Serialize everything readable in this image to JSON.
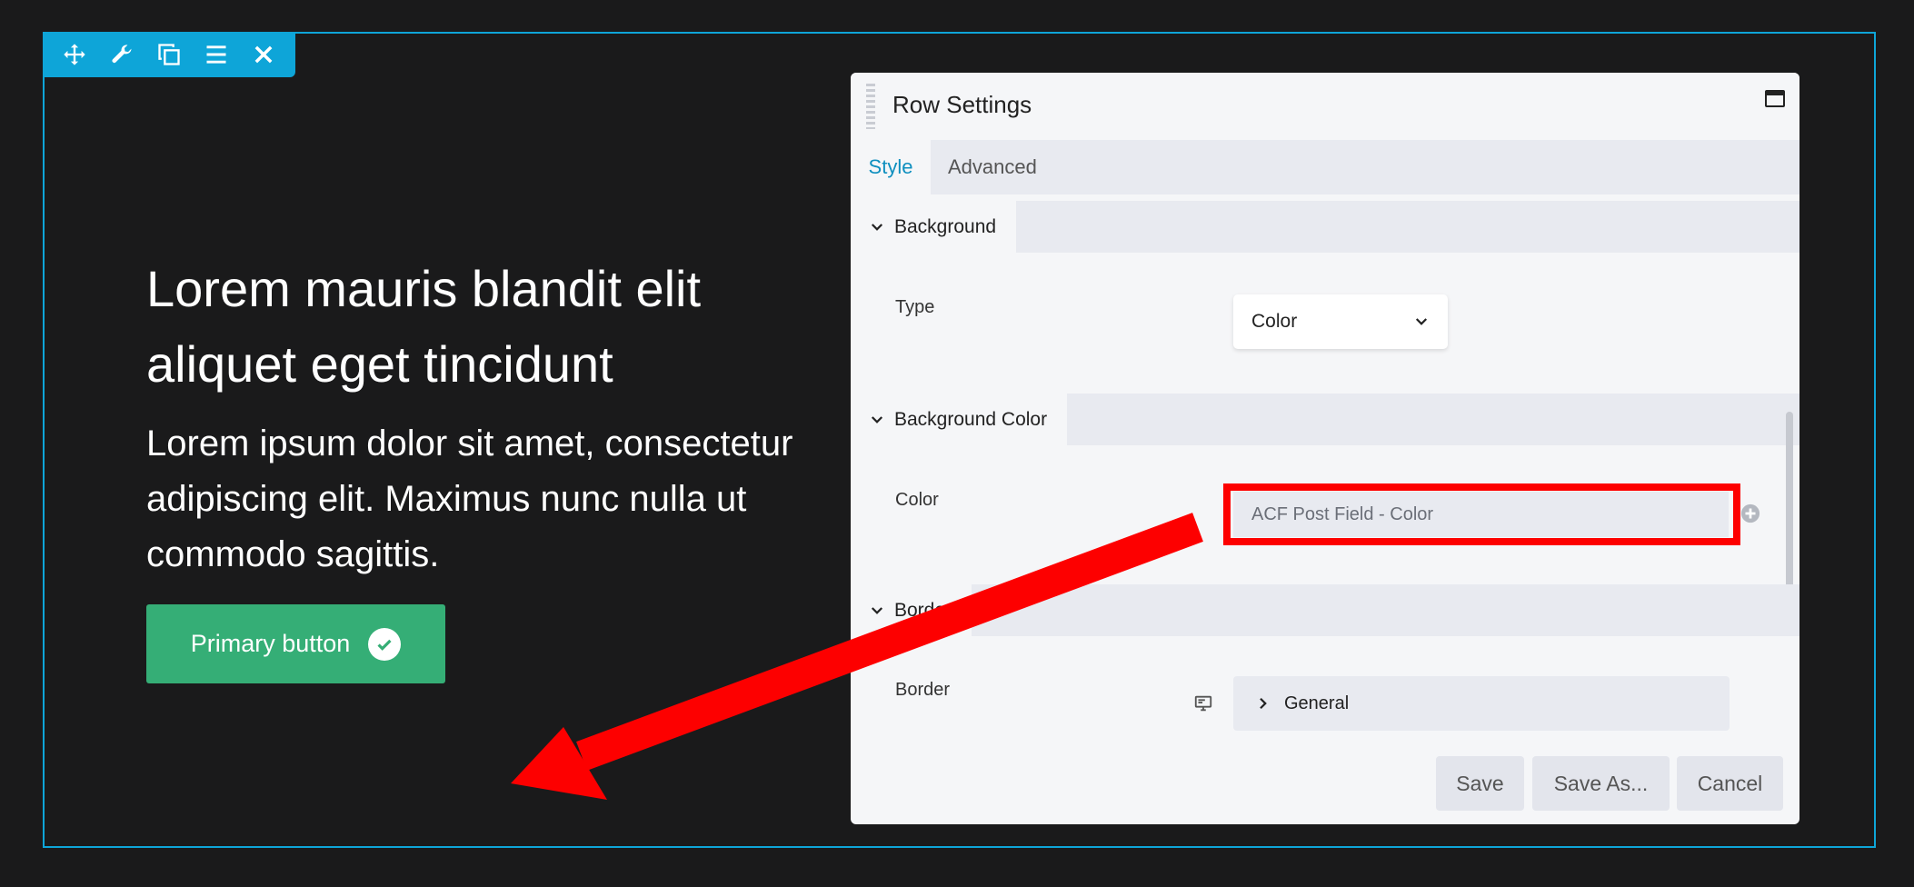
{
  "toolbar": {
    "icons": [
      "move-icon",
      "wrench-icon",
      "duplicate-icon",
      "menu-icon",
      "close-icon"
    ]
  },
  "hero": {
    "heading": "Lorem mauris blandit elit aliquet eget tincidunt",
    "text": "Lorem ipsum dolor sit amet, consectetur adipiscing elit. Maximus nunc nulla ut commodo sagittis.",
    "button_label": "Primary button"
  },
  "panel": {
    "title": "Row Settings",
    "tabs": [
      {
        "label": "Style",
        "active": true
      },
      {
        "label": "Advanced",
        "active": false
      }
    ],
    "sections": {
      "background": {
        "title": "Background",
        "type_label": "Type",
        "type_value": "Color"
      },
      "background_color": {
        "title": "Background Color",
        "color_label": "Color",
        "color_value": "ACF Post Field - Color"
      },
      "border": {
        "title": "Border",
        "border_label": "Border",
        "general_label": "General"
      }
    },
    "footer": {
      "save": "Save",
      "save_as": "Save As...",
      "cancel": "Cancel"
    }
  },
  "colors": {
    "accent": "#0ea5d8",
    "primary_button": "#35ae76",
    "highlight": "#fd0000",
    "background": "#1a1a1b"
  }
}
